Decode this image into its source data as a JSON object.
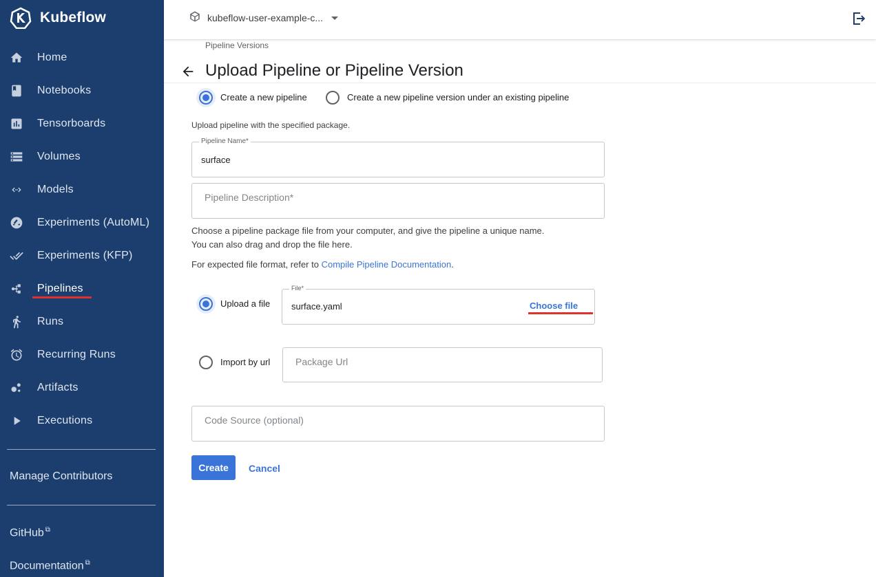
{
  "app": {
    "name": "Kubeflow",
    "logo_icon": "kubeflow-logo-icon"
  },
  "sidebar": {
    "items": [
      {
        "label": "Home",
        "icon": "home-icon"
      },
      {
        "label": "Notebooks",
        "icon": "book-icon"
      },
      {
        "label": "Tensorboards",
        "icon": "bar-chart-icon"
      },
      {
        "label": "Volumes",
        "icon": "storage-icon"
      },
      {
        "label": "Models",
        "icon": "code-arrows-icon"
      },
      {
        "label": "Experiments (AutoML)",
        "icon": "speedometer-icon"
      },
      {
        "label": "Experiments (KFP)",
        "icon": "done-all-icon"
      },
      {
        "label": "Pipelines",
        "icon": "pipeline-icon",
        "active": true
      },
      {
        "label": "Runs",
        "icon": "run-icon"
      },
      {
        "label": "Recurring Runs",
        "icon": "alarm-icon"
      },
      {
        "label": "Artifacts",
        "icon": "bubbles-icon"
      },
      {
        "label": "Executions",
        "icon": "play-icon"
      }
    ],
    "manage_contributors": "Manage Contributors",
    "github": "GitHub",
    "documentation": "Documentation",
    "external_link_icon": "external-link-icon"
  },
  "topbar": {
    "namespace": "kubeflow-user-example-c...",
    "namespace_icon": "cube-icon",
    "logout_icon": "logout-icon"
  },
  "page": {
    "breadcrumb": "Pipeline Versions",
    "title": "Upload Pipeline or Pipeline Version"
  },
  "form": {
    "mode_options": [
      {
        "label": "Create a new pipeline",
        "selected": true
      },
      {
        "label": "Create a new pipeline version under an existing pipeline",
        "selected": false
      }
    ],
    "intro": "Upload pipeline with the specified package.",
    "pipeline_name": {
      "label": "Pipeline Name*",
      "value": "surface"
    },
    "pipeline_description": {
      "placeholder": "Pipeline Description*"
    },
    "help_line1": "Choose a pipeline package file from your computer, and give the pipeline a unique name.",
    "help_line2": "You can also drag and drop the file here.",
    "format_prefix": "For expected file format, refer to ",
    "format_link": "Compile Pipeline Documentation",
    "format_suffix": ".",
    "upload": {
      "label": "Upload a file",
      "selected": true,
      "field_label": "File*",
      "value": "surface.yaml",
      "choose_label": "Choose file"
    },
    "import": {
      "label": "Import by url",
      "selected": false,
      "placeholder": "Package Url"
    },
    "code_source": {
      "placeholder": "Code Source (optional)"
    },
    "create_label": "Create",
    "cancel_label": "Cancel"
  },
  "colors": {
    "sidebar_bg": "#1c3e6e",
    "accent": "#3b74d8",
    "highlight": "#e0322c"
  }
}
